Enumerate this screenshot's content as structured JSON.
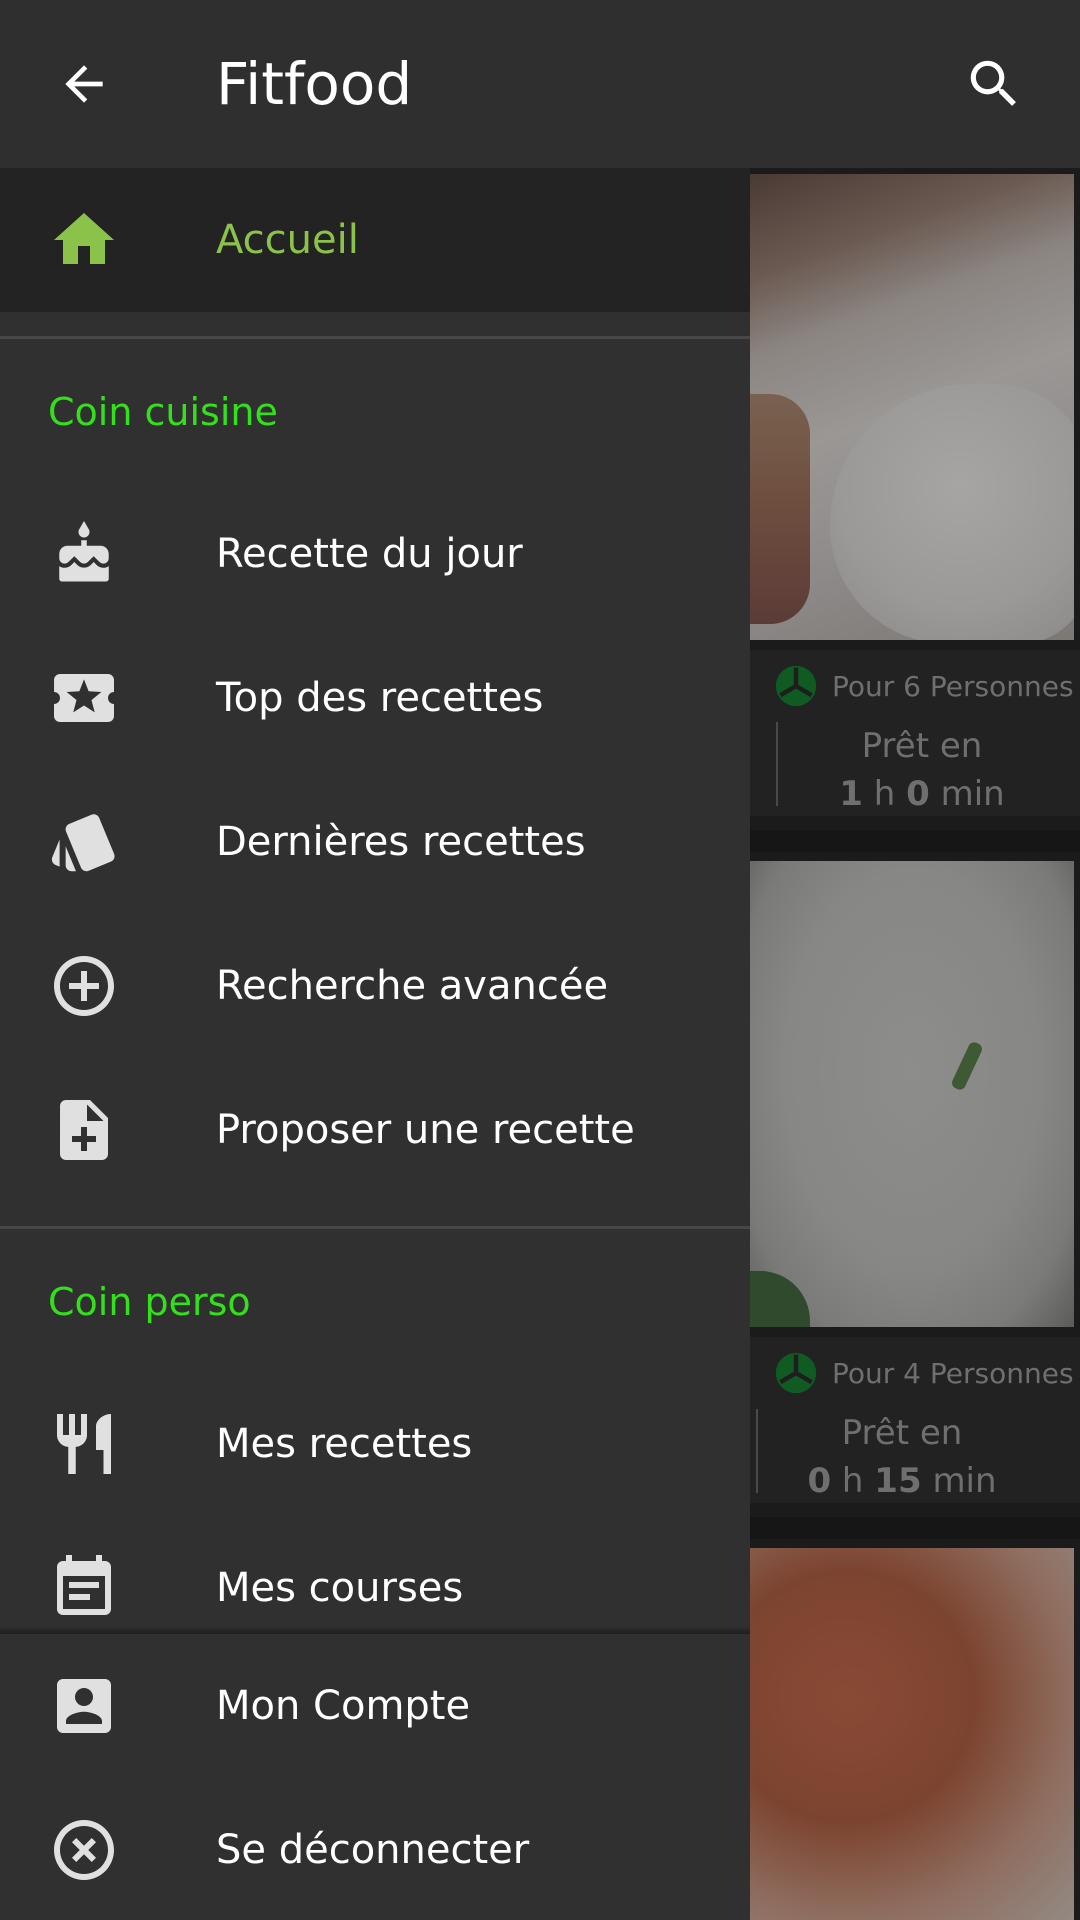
{
  "toolbar": {
    "title": "Fitfood",
    "back_icon": "arrow-left-icon",
    "search_icon": "search-icon"
  },
  "drawer": {
    "home": {
      "label": "Accueil",
      "icon": "home-icon",
      "active": true
    },
    "sections": [
      {
        "title": "Coin cuisine",
        "items": [
          {
            "label": "Recette du jour",
            "icon": "cake-icon"
          },
          {
            "label": "Top des recettes",
            "icon": "star-ticket-icon"
          },
          {
            "label": "Dernières recettes",
            "icon": "cards-icon"
          },
          {
            "label": "Recherche avancée",
            "icon": "add-circle-icon"
          },
          {
            "label": "Proposer une recette",
            "icon": "note-add-icon"
          }
        ]
      },
      {
        "title": "Coin perso",
        "items": [
          {
            "label": "Mes recettes",
            "icon": "fork-knife-icon"
          },
          {
            "label": "Mes courses",
            "icon": "calendar-note-icon"
          }
        ]
      }
    ],
    "footer": [
      {
        "label": "Mon Compte",
        "icon": "account-box-icon"
      },
      {
        "label": "Se déconnecter",
        "icon": "close-circle-icon"
      }
    ]
  },
  "cards": [
    {
      "people": "Pour 6 Personnes",
      "ready_label": "Prêt en",
      "hours": "1",
      "h_unit": "h",
      "minutes": "0",
      "min_unit": "min"
    },
    {
      "people": "Pour 4 Personnes",
      "ready_label": "Prêt en",
      "hours": "0",
      "h_unit": "h",
      "minutes": "15",
      "min_unit": "min"
    }
  ],
  "colors": {
    "accent_green": "#8bc34a",
    "section_green": "#33e01b",
    "drawer_bg": "#303030",
    "toolbar_bg": "#2f2f2f"
  }
}
